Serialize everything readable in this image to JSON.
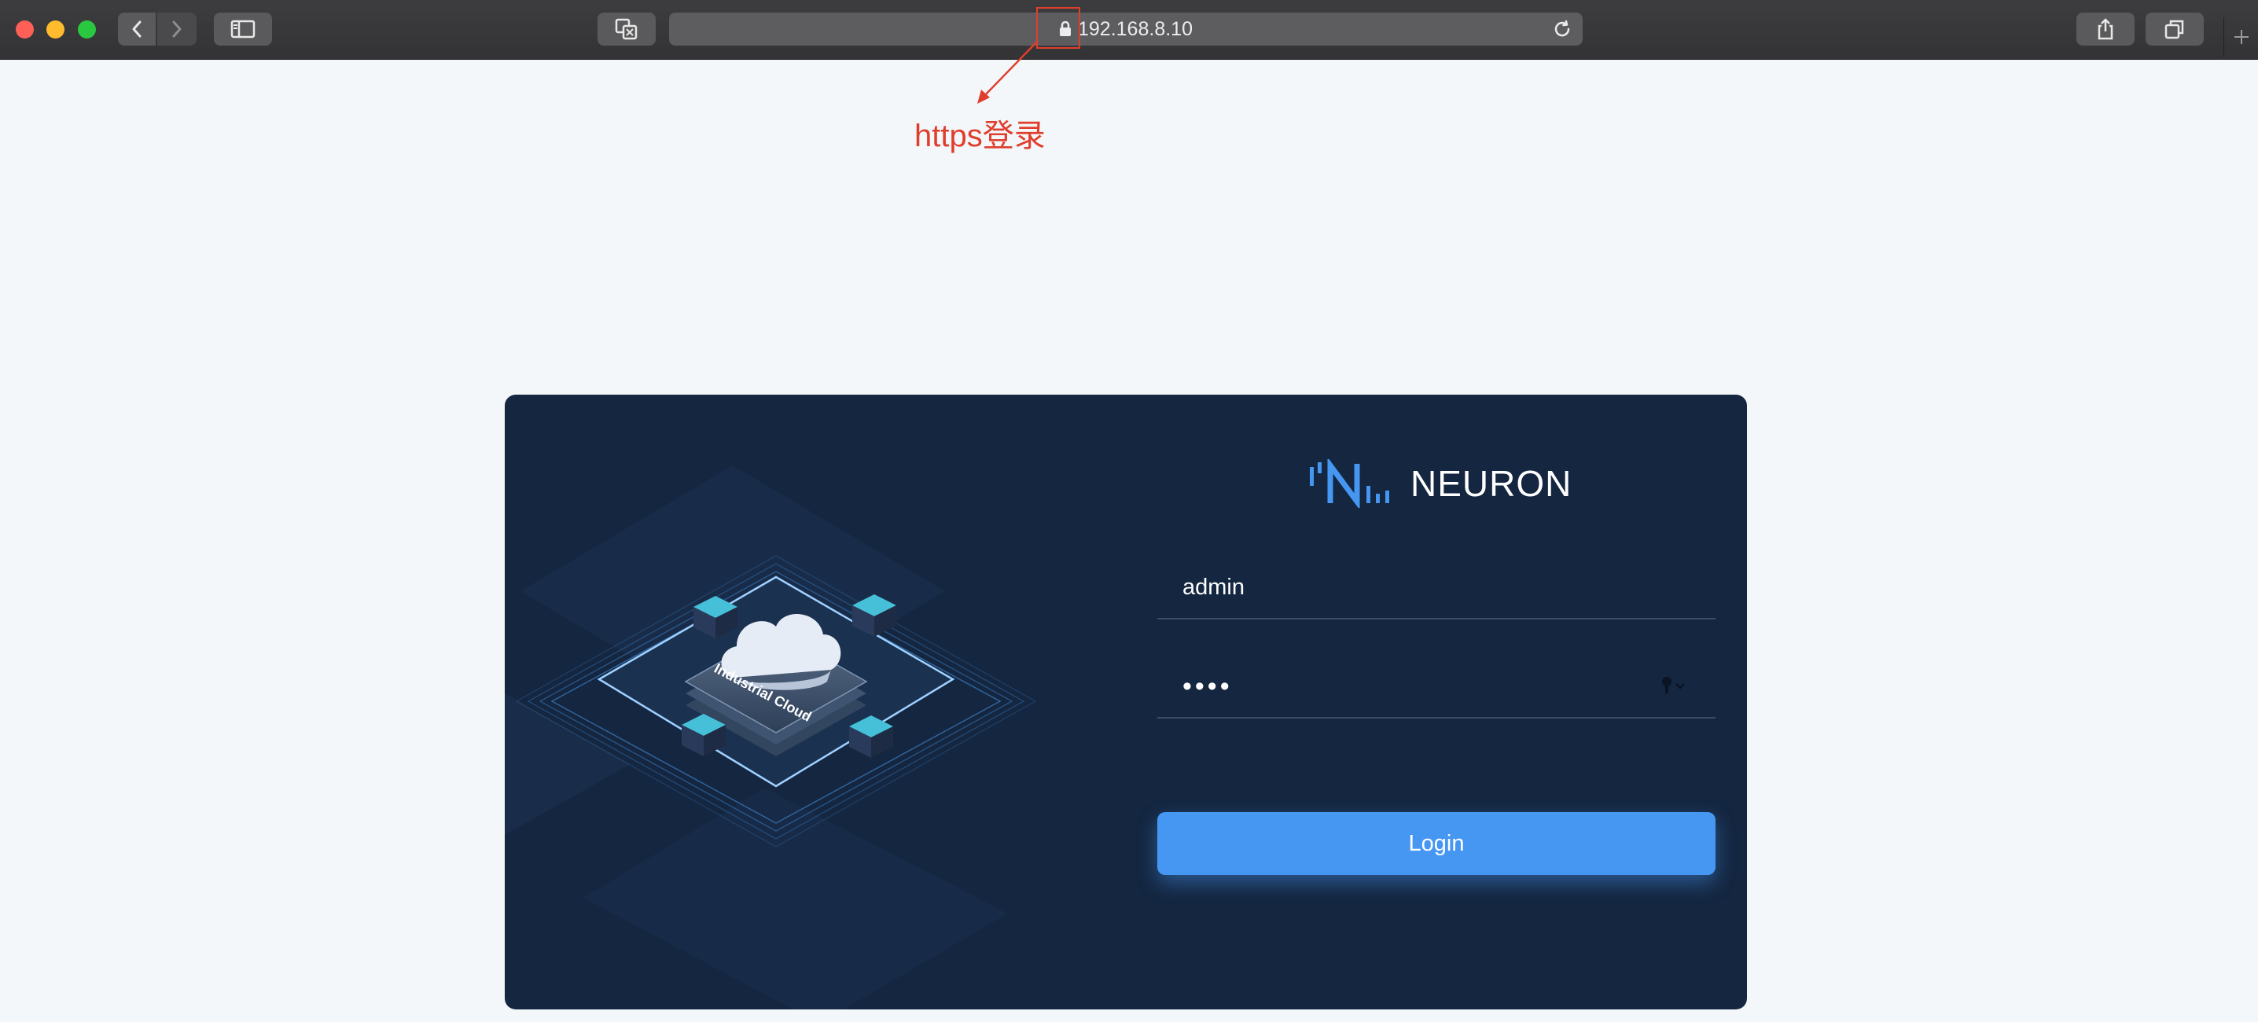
{
  "browser": {
    "address_url": "192.168.8.10",
    "icons": [
      "back-icon",
      "forward-icon",
      "sidebar-icon",
      "translate-icon",
      "lock-icon",
      "reload-icon",
      "share-icon",
      "tabs-icon",
      "new-tab-icon"
    ]
  },
  "annotation": {
    "text": "https登录",
    "color": "#e03e2d"
  },
  "illustration": {
    "label": "Industrial Cloud"
  },
  "login": {
    "brand_name": "NEURON",
    "username_value": "admin",
    "password_value": "••••",
    "submit_label": "Login"
  },
  "colors": {
    "card_background": "#142640",
    "accent": "#4697f2",
    "page_background": "#f3f7fa"
  }
}
